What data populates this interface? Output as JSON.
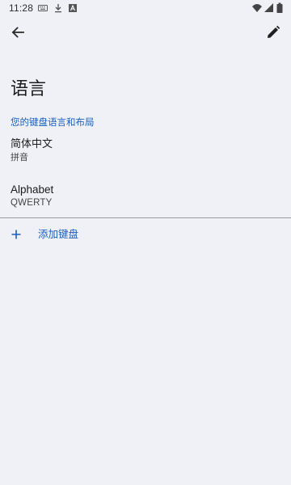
{
  "status_bar": {
    "time": "11:28",
    "notification_icons": [
      "keyboard-icon",
      "download-icon",
      "font-icon"
    ],
    "system_icons": [
      "wifi-icon",
      "signal-icon",
      "battery-icon"
    ]
  },
  "app_bar": {
    "back_icon": "arrow-back-icon",
    "edit_icon": "pencil-icon"
  },
  "page": {
    "title": "语言",
    "section_header": "您的键盘语言和布局",
    "keyboards": [
      {
        "language": "简体中文",
        "layout": "拼音"
      },
      {
        "language": "Alphabet",
        "layout": "QWERTY"
      }
    ],
    "add_keyboard_label": "添加键盘",
    "add_icon": "plus-icon"
  },
  "colors": {
    "background": "#eff1f6",
    "accent": "#1a5fc6",
    "divider": "#9a9ca0",
    "text_primary": "#1b1b1b"
  }
}
